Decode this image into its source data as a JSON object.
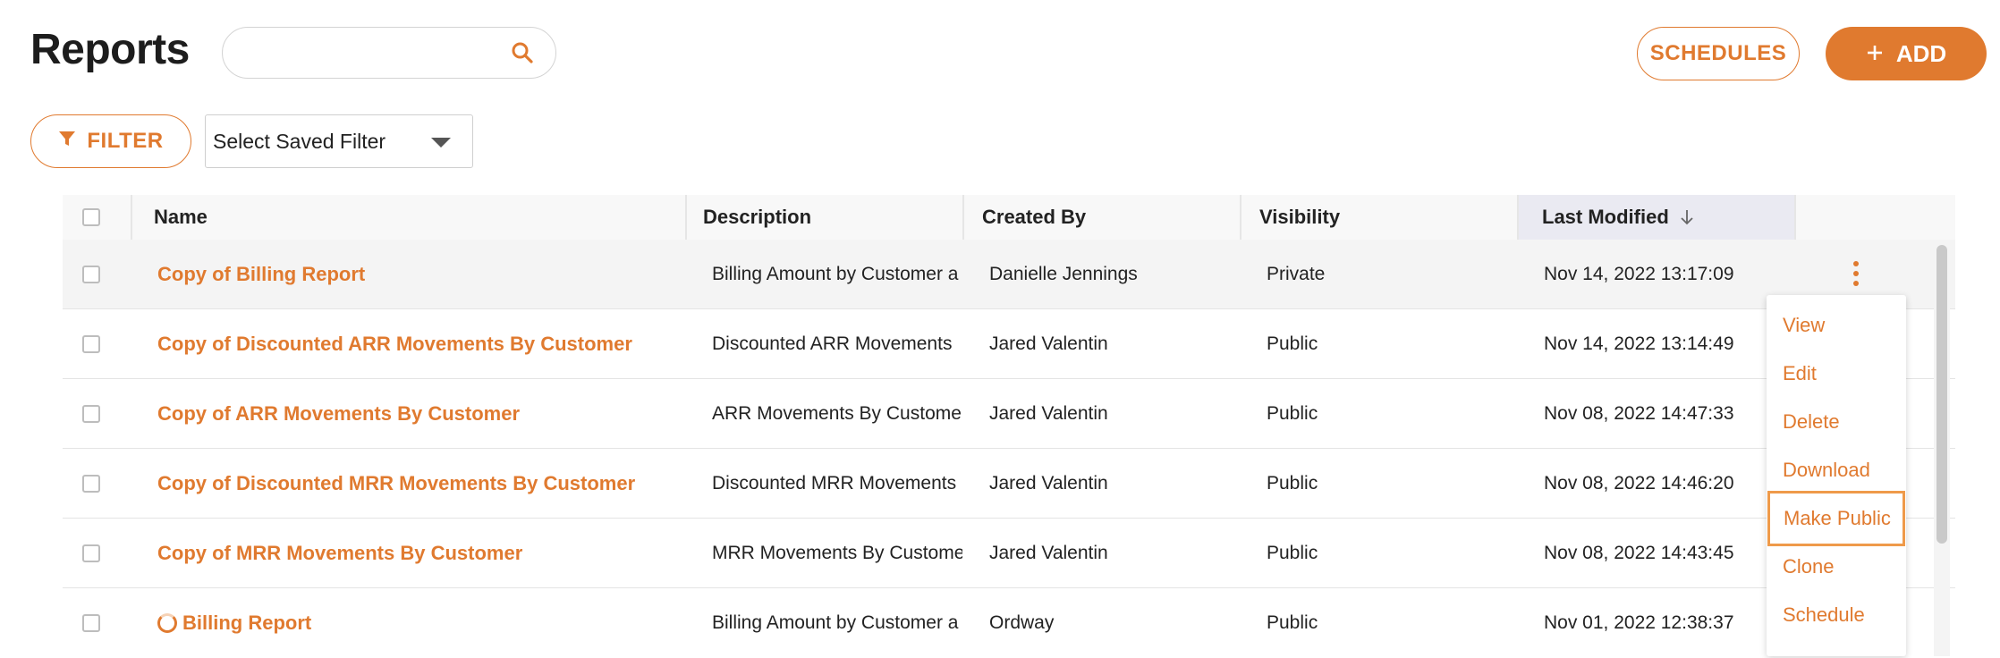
{
  "header": {
    "title": "Reports",
    "search_value": "",
    "schedules_label": "SCHEDULES",
    "add_label": "ADD"
  },
  "filters": {
    "filter_label": "FILTER",
    "saved_filter_value": "Select Saved Filter"
  },
  "table": {
    "columns": {
      "name": "Name",
      "description": "Description",
      "created_by": "Created By",
      "visibility": "Visibility",
      "last_modified": "Last Modified"
    },
    "sort": {
      "column": "last_modified",
      "direction": "descending"
    },
    "rows": [
      {
        "name": "Copy of Billing Report",
        "description": "Billing Amount by Customer a",
        "created_by": "Danielle Jennings",
        "visibility": "Private",
        "last_modified": "Nov 14, 2022 13:17:09"
      },
      {
        "name": "Copy of Discounted ARR Movements By Customer",
        "description": "Discounted ARR Movements",
        "created_by": "Jared Valentin",
        "visibility": "Public",
        "last_modified": "Nov 14, 2022 13:14:49"
      },
      {
        "name": "Copy of ARR Movements By Customer",
        "description": "ARR Movements By Custome",
        "created_by": "Jared Valentin",
        "visibility": "Public",
        "last_modified": "Nov 08, 2022 14:47:33"
      },
      {
        "name": "Copy of Discounted MRR Movements By Customer",
        "description": "Discounted MRR Movements",
        "created_by": "Jared Valentin",
        "visibility": "Public",
        "last_modified": "Nov 08, 2022 14:46:20"
      },
      {
        "name": "Copy of MRR Movements By Customer",
        "description": "MRR Movements By Custome",
        "created_by": "Jared Valentin",
        "visibility": "Public",
        "last_modified": "Nov 08, 2022 14:43:45"
      },
      {
        "name": "Billing Report",
        "description": "Billing Amount by Customer a",
        "created_by": "Ordway",
        "visibility": "Public",
        "last_modified": "Nov 01, 2022 12:38:37"
      }
    ]
  },
  "row_menu": {
    "items": [
      "View",
      "Edit",
      "Delete",
      "Download",
      "Make Public",
      "Clone",
      "Schedule"
    ],
    "active_item": "Make Public"
  },
  "colors": {
    "accent": "#e07a2f",
    "menu_focus_border": "#ef9a4a"
  },
  "icons": [
    "search-icon",
    "filter-icon",
    "plus-icon",
    "sort-arrow-down-icon",
    "kebab-menu-icon",
    "loading-spinner-icon"
  ]
}
